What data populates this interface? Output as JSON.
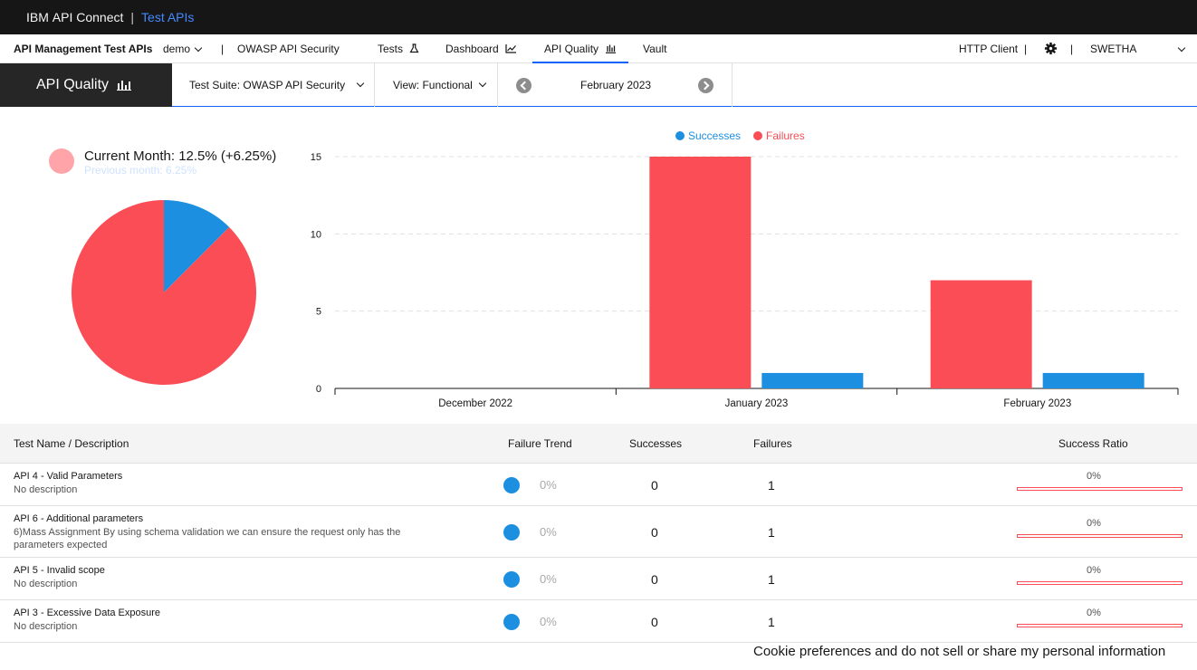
{
  "topbar": {
    "ibm": "IBM",
    "product": "API Connect",
    "separator": "|",
    "app": "Test APIs"
  },
  "nav": {
    "brand": "API Management Test APIs",
    "org": "demo",
    "separator": "|",
    "project": "OWASP API Security",
    "tabs": [
      {
        "label": "Tests",
        "icon": "flask-icon"
      },
      {
        "label": "Dashboard",
        "icon": "line-chart-icon"
      },
      {
        "label": "API Quality",
        "icon": "bar-chart-icon",
        "active": true
      },
      {
        "label": "Vault"
      }
    ],
    "http_client": "HTTP Client",
    "separator2": "|",
    "separator3": "|",
    "user": "SWETHA"
  },
  "subbar": {
    "title": "API Quality",
    "test_suite": "Test Suite: OWASP API Security",
    "view": "View: Functional",
    "month": "February 2023"
  },
  "summary": {
    "current": "Current Month: 12.5% (+6.25%)",
    "previous": "Previous month: 6.25%"
  },
  "colors": {
    "success": "#1d8fe1",
    "failure": "#fa4d56",
    "accent": "#0f62fe"
  },
  "chart_data": [
    {
      "type": "pie",
      "labels": [
        "Successes",
        "Failures"
      ],
      "values": [
        12.5,
        87.5
      ]
    },
    {
      "type": "bar",
      "categories": [
        "December 2022",
        "January 2023",
        "February 2023"
      ],
      "series": [
        {
          "name": "Failures",
          "values": [
            0,
            15,
            7
          ]
        },
        {
          "name": "Successes",
          "values": [
            0,
            1,
            1
          ]
        }
      ],
      "legend": [
        "Successes",
        "Failures"
      ],
      "yticks": [
        0,
        5,
        10,
        15
      ],
      "ylim": [
        0,
        16
      ],
      "grid": true,
      "legend_position": "top-center"
    }
  ],
  "table": {
    "headers": {
      "name": "Test Name / Description",
      "trend": "Failure Trend",
      "successes": "Successes",
      "failures": "Failures",
      "ratio": "Success Ratio"
    },
    "rows": [
      {
        "name": "API 4 - Valid Parameters",
        "desc": "No description",
        "trend": "0%",
        "successes": "0",
        "failures": "1",
        "ratio": "0%",
        "ratio_value": 0
      },
      {
        "name": "API 6 - Additional parameters",
        "desc": "6)Mass Assignment By using schema validation we can ensure the request only has the parameters expected",
        "trend": "0%",
        "successes": "0",
        "failures": "1",
        "ratio": "0%",
        "ratio_value": 0
      },
      {
        "name": "API 5 - Invalid scope",
        "desc": "No description",
        "trend": "0%",
        "successes": "0",
        "failures": "1",
        "ratio": "0%",
        "ratio_value": 0
      },
      {
        "name": "API 3 - Excessive Data Exposure",
        "desc": "No description",
        "trend": "0%",
        "successes": "0",
        "failures": "1",
        "ratio": "0%",
        "ratio_value": 0
      }
    ]
  },
  "cookie": "Cookie preferences and do not sell or share my personal information"
}
